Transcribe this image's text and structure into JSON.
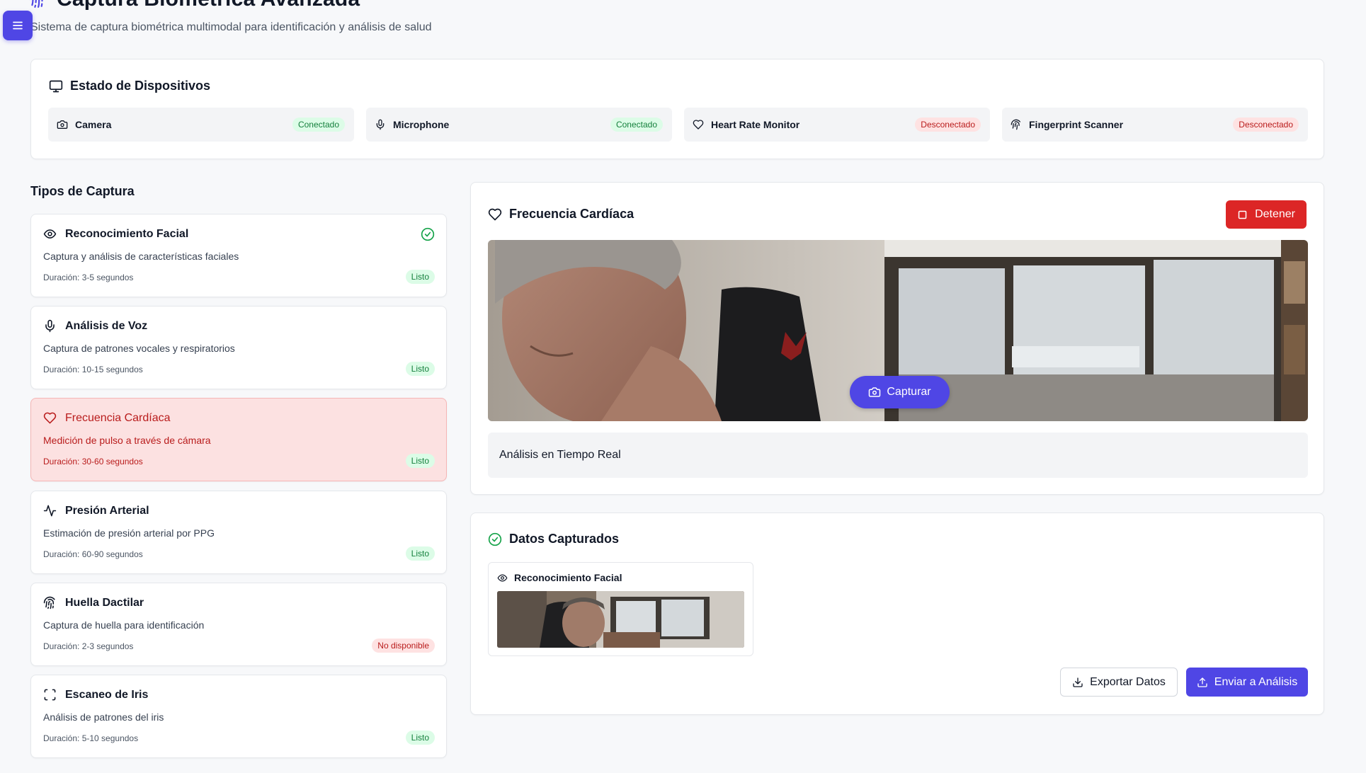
{
  "header": {
    "title": "Captura Biométrica Avanzada",
    "subtitle": "Sistema de captura biométrica multimodal para identificación y análisis de salud"
  },
  "devices": {
    "title": "Estado de Dispositivos",
    "items": [
      {
        "name": "Camera",
        "status": "Conectado",
        "icon": "camera-icon"
      },
      {
        "name": "Microphone",
        "status": "Conectado",
        "icon": "microphone-icon"
      },
      {
        "name": "Heart Rate Monitor",
        "status": "Desconectado",
        "icon": "heart-icon"
      },
      {
        "name": "Fingerprint Scanner",
        "status": "Desconectado",
        "icon": "fingerprint-icon"
      }
    ]
  },
  "capture_types": {
    "title": "Tipos de Captura",
    "items": [
      {
        "name": "Reconocimiento Facial",
        "description": "Captura y análisis de características faciales",
        "duration": "Duración: 3-5 segundos",
        "status": "Listo",
        "icon": "eye-icon",
        "completed": true
      },
      {
        "name": "Análisis de Voz",
        "description": "Captura de patrones vocales y respiratorios",
        "duration": "Duración: 10-15 segundos",
        "status": "Listo",
        "icon": "microphone-icon"
      },
      {
        "name": "Frecuencia Cardíaca",
        "description": "Medición de pulso a través de cámara",
        "duration": "Duración: 30-60 segundos",
        "status": "Listo",
        "icon": "heart-icon",
        "active": true
      },
      {
        "name": "Presión Arterial",
        "description": "Estimación de presión arterial por PPG",
        "duration": "Duración: 60-90 segundos",
        "status": "Listo",
        "icon": "activity-icon"
      },
      {
        "name": "Huella Dactilar",
        "description": "Captura de huella para identificación",
        "duration": "Duración: 2-3 segundos",
        "status": "No disponible",
        "icon": "fingerprint-icon"
      },
      {
        "name": "Escaneo de Iris",
        "description": "Análisis de patrones del iris",
        "duration": "Duración: 5-10 segundos",
        "status": "Listo",
        "icon": "scan-icon"
      }
    ]
  },
  "active_capture": {
    "title": "Frecuencia Cardíaca",
    "stop_label": "Detener",
    "capture_label": "Capturar",
    "realtime_label": "Análisis en Tiempo Real"
  },
  "captured_data": {
    "title": "Datos Capturados",
    "items": [
      {
        "name": "Reconocimiento Facial",
        "icon": "eye-icon"
      }
    ],
    "export_label": "Exportar Datos",
    "send_label": "Enviar a Análisis"
  },
  "colors": {
    "accent": "#4f46e5",
    "danger": "#dc2626",
    "success": "#16a34a",
    "active_bg": "#fce1e1"
  }
}
